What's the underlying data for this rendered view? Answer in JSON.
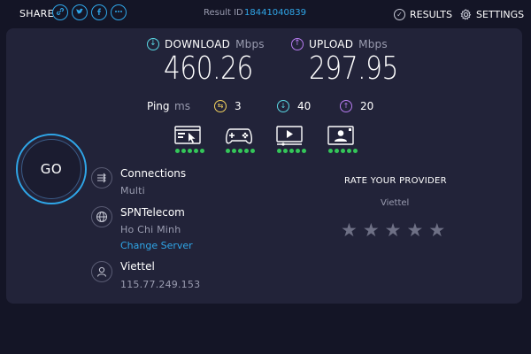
{
  "topbar": {
    "share_label": "SHARE",
    "share_icons": [
      {
        "icon": "link-icon",
        "glyph": "🔗"
      },
      {
        "icon": "twitter-icon",
        "glyph": "t"
      },
      {
        "icon": "facebook-icon",
        "glyph": "f"
      },
      {
        "icon": "more-icon",
        "glyph": "•••"
      }
    ],
    "result_id_label": "Result ID",
    "result_id_value": "18441040839",
    "results_label": "RESULTS",
    "settings_label": "SETTINGS"
  },
  "metrics": {
    "download": {
      "label": "DOWNLOAD",
      "unit": "Mbps",
      "value": "460.26"
    },
    "upload": {
      "label": "UPLOAD",
      "unit": "Mbps",
      "value": "297.95"
    }
  },
  "ping": {
    "label": "Ping",
    "unit": "ms",
    "idle": "3",
    "download": "40",
    "upload": "20"
  },
  "app_ratings": [
    {
      "name": "browsing-icon",
      "dots": 5
    },
    {
      "name": "gaming-icon",
      "dots": 5
    },
    {
      "name": "streaming-icon",
      "dots": 5
    },
    {
      "name": "video-call-icon",
      "dots": 5
    }
  ],
  "go_label": "GO",
  "connections": {
    "title": "Connections",
    "value": "Multi"
  },
  "server": {
    "title": "SPNTelecom",
    "location": "Ho Chi Minh",
    "change_label": "Change Server"
  },
  "provider": {
    "title": "Viettel",
    "ip": "115.77.249.153"
  },
  "rating": {
    "title": "RATE YOUR PROVIDER",
    "provider": "Viettel",
    "stars": 5
  },
  "colors": {
    "accent": "#2fa6e8",
    "download": "#5ad8e4",
    "upload": "#b77cf0",
    "ping_idle": "#f4d35e",
    "good": "#34c759",
    "panel": "#222339",
    "background": "#141526"
  }
}
